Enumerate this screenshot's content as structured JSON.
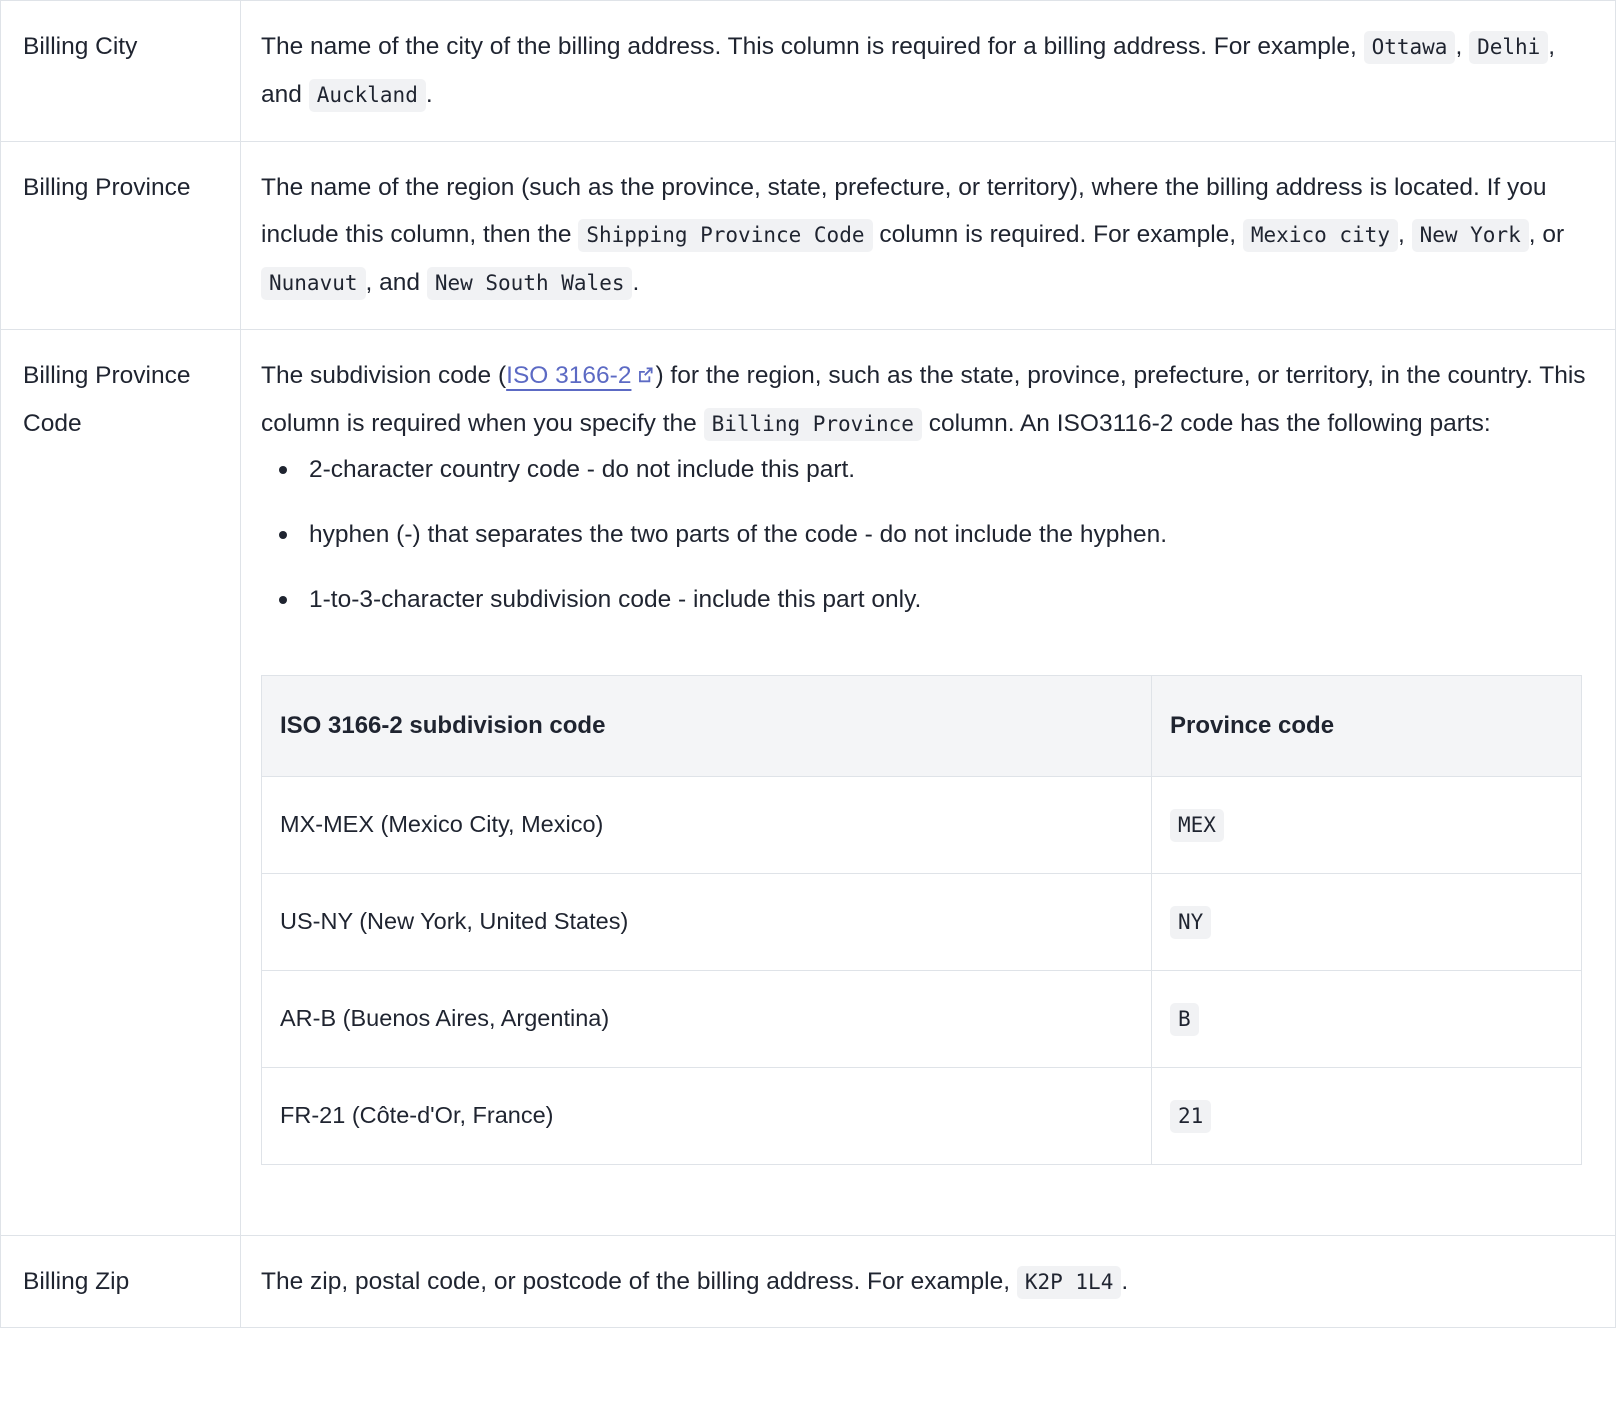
{
  "colors": {
    "text": "#1f2430",
    "border": "#dfe3e8",
    "chip_bg": "#f1f2f4",
    "link": "#5c6ac4",
    "header_bg": "#f4f5f7"
  },
  "rows": [
    {
      "name": "Billing City",
      "desc_part_1": "The name of the city of the billing address. This column is required for a billing address. For example,",
      "code_1": "Ottawa",
      "sep_1": ",",
      "code_2": "Delhi",
      "sep_2": ", and",
      "code_3": "Auckland",
      "sep_3": "."
    },
    {
      "name": "Billing Province",
      "desc_part_1": "The name of the region (such as the province, state, prefecture, or territory), where the billing address is located. If you include this column, then the",
      "code_1": "Shipping Province Code",
      "desc_part_2": "column is required. For example,",
      "code_2": "Mexico city",
      "sep_2": ",",
      "code_3": "New York",
      "sep_3": ", or",
      "code_4": "Nunavut",
      "sep_4": ", and",
      "code_5": "New South Wales",
      "sep_5": "."
    },
    {
      "name": "Billing Province Code",
      "desc_part_1": "The subdivision code (",
      "link_label": "ISO 3166-2",
      "link_icon": "external-link-icon",
      "desc_part_2": ") for the region, such as the state, province, prefecture, or territory, in the country. This column is required when you specify the",
      "code_1": "Billing Province",
      "desc_part_3": "column. An ISO3116-2 code has the following parts:",
      "bullets": [
        "2-character country code - do not include this part.",
        "hyphen (-) that separates the two parts of the code - do not include the hyphen.",
        "1-to-3-character subdivision code - include this part only."
      ],
      "inner_table": {
        "headers": [
          "ISO 3166-2 subdivision code",
          "Province code"
        ],
        "rows": [
          {
            "subdivision": "MX-MEX (Mexico City, Mexico)",
            "code": "MEX"
          },
          {
            "subdivision": "US-NY (New York, United States)",
            "code": "NY"
          },
          {
            "subdivision": "AR-B (Buenos Aires, Argentina)",
            "code": "B"
          },
          {
            "subdivision": "FR-21 (Côte-d'Or, France)",
            "code": "21"
          }
        ]
      }
    },
    {
      "name": "Billing Zip",
      "desc_part_1": "The zip, postal code, or postcode of the billing address. For example,",
      "code_1": "K2P 1L4",
      "sep_1": "."
    }
  ]
}
